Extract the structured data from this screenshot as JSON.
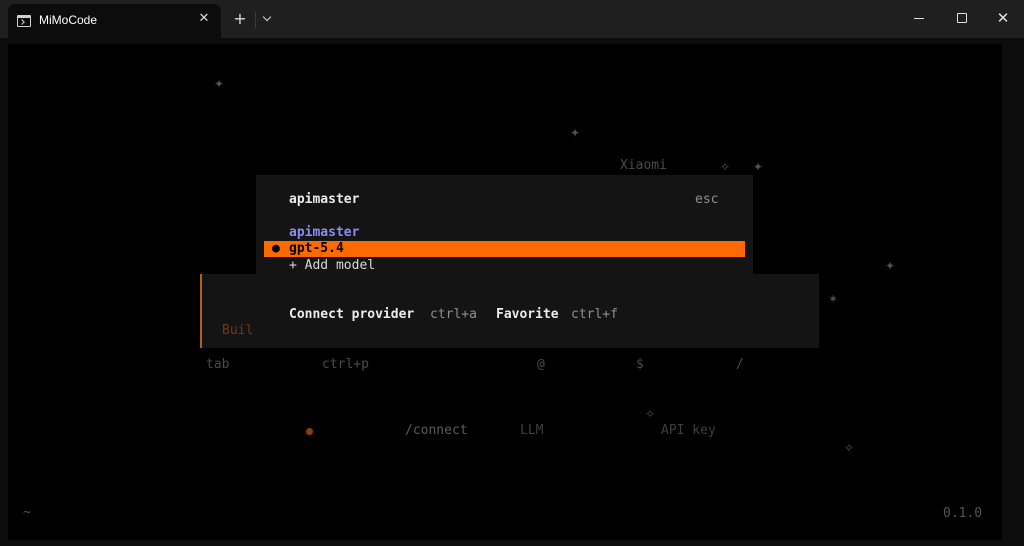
{
  "window": {
    "tab_title": "MiMoCode",
    "tab_icon": "terminal-icon",
    "close_tab_glyph": "✕",
    "new_tab_glyph": "+",
    "close_window_glyph": "✕"
  },
  "background": {
    "logo_fragment": "Xiaomi",
    "input_placeholder_fragment": "Buil",
    "hint_row": [
      "tab",
      "ctrl+p",
      "@",
      "$",
      "/"
    ],
    "connect_hint": [
      "/connect",
      "LLM",
      "API key"
    ],
    "cwd": "~",
    "version": "0.1.0",
    "stars": [
      "✦",
      "✦",
      "✧",
      "✦",
      "✦",
      "✶",
      "✧",
      "✧"
    ]
  },
  "dialog": {
    "title": "apimaster",
    "esc_label": "esc",
    "provider_heading": "apimaster",
    "selected_bullet": "●",
    "models": [
      "gpt-5.4"
    ],
    "add_model": "+ Add model",
    "footer": {
      "connect_label": "Connect provider",
      "connect_key": "ctrl+a",
      "favorite_label": "Favorite",
      "favorite_key": "ctrl+f"
    }
  },
  "colors": {
    "accent": "#ff6a00",
    "provider": "#8b8ef0",
    "dialog_bg": "#141414",
    "terminal_bg": "#000000"
  }
}
